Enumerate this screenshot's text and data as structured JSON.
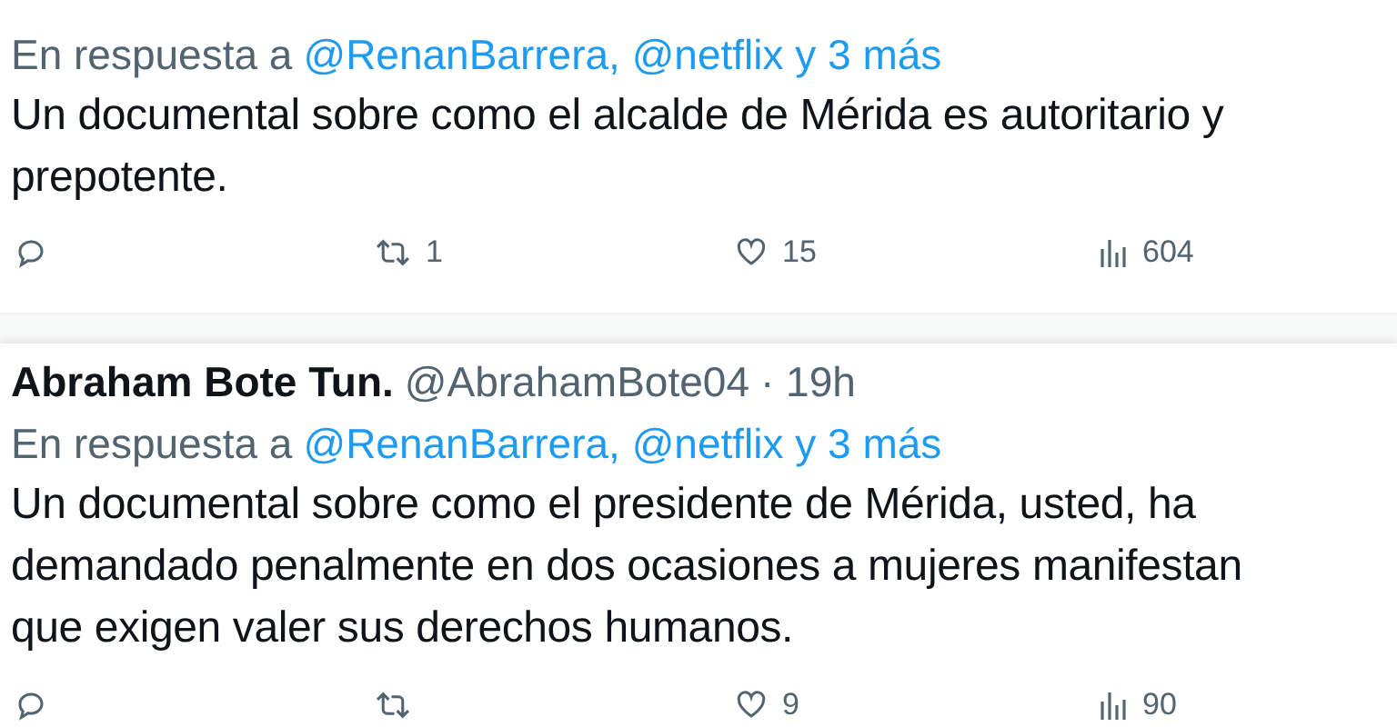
{
  "tweets": [
    {
      "reply_prefix": "En respuesta a",
      "reply_to": "@RenanBarrera, @netflix y 3 más",
      "text": "Un documental sobre como el alcalde de Mérida es autoritario y\nprepotente.",
      "actions": [
        {
          "kind": "reply"
        },
        {
          "kind": "retweet",
          "count": "1"
        },
        {
          "kind": "like",
          "count": "15"
        },
        {
          "kind": "views",
          "count": "604"
        }
      ]
    },
    {
      "name": "Abraham Bote Tun.",
      "handle": "@AbrahamBote04",
      "time": "· 19h",
      "reply_prefix": "En respuesta a",
      "reply_to": "@RenanBarrera, @netflix y 3 más",
      "text": "Un documental sobre como el presidente de Mérida, usted, ha\ndemandado penalmente en dos ocasiones a mujeres manifestan\nque exigen valer sus derechos humanos.",
      "actions": [
        {
          "kind": "reply"
        },
        {
          "kind": "retweet"
        },
        {
          "kind": "like",
          "count": "9"
        },
        {
          "kind": "views",
          "count": "90"
        }
      ]
    }
  ]
}
